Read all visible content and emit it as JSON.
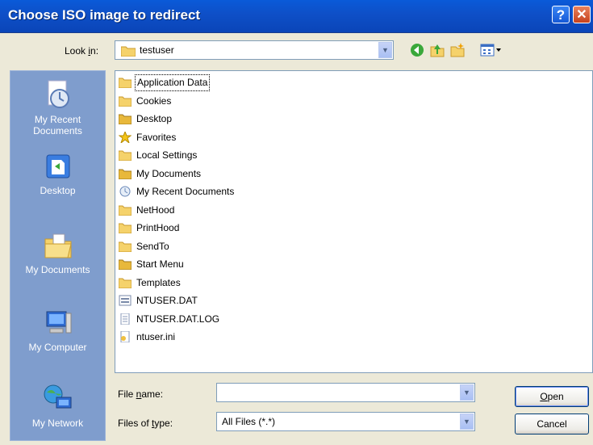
{
  "window": {
    "title": "Choose ISO image to redirect",
    "help_icon": "question-icon",
    "close_icon": "close-icon"
  },
  "toolbar": {
    "lookin_label_pre": "Look ",
    "lookin_label_u": "i",
    "lookin_label_post": "n:",
    "lookin_value": "testuser",
    "tools": [
      "back-icon",
      "up-folder-icon",
      "new-folder-icon",
      "views-menu-icon"
    ]
  },
  "places": [
    {
      "label": "My Recent Documents",
      "icon": "recent-documents-icon"
    },
    {
      "label": "Desktop",
      "icon": "desktop-icon"
    },
    {
      "label": "My Documents",
      "icon": "my-documents-icon"
    },
    {
      "label": "My Computer",
      "icon": "my-computer-icon"
    },
    {
      "label": "My Network",
      "icon": "my-network-icon"
    }
  ],
  "files": [
    {
      "name": "Application Data",
      "icon": "folder"
    },
    {
      "name": "Cookies",
      "icon": "folder"
    },
    {
      "name": "Desktop",
      "icon": "folder-special"
    },
    {
      "name": "Favorites",
      "icon": "favorites"
    },
    {
      "name": "Local Settings",
      "icon": "folder"
    },
    {
      "name": "My Documents",
      "icon": "folder-special"
    },
    {
      "name": "My Recent Documents",
      "icon": "recent"
    },
    {
      "name": "NetHood",
      "icon": "folder"
    },
    {
      "name": "PrintHood",
      "icon": "folder"
    },
    {
      "name": "SendTo",
      "icon": "folder"
    },
    {
      "name": "Start Menu",
      "icon": "folder-special"
    },
    {
      "name": "Templates",
      "icon": "folder"
    },
    {
      "name": "NTUSER.DAT",
      "icon": "dat-file"
    },
    {
      "name": "NTUSER.DAT.LOG",
      "icon": "log-file"
    },
    {
      "name": "ntuser.ini",
      "icon": "ini-file"
    }
  ],
  "form": {
    "filename_label_pre": "File ",
    "filename_label_u": "n",
    "filename_label_post": "ame:",
    "filename_value": "",
    "filetype_label_pre": "Files of ",
    "filetype_label_u": "t",
    "filetype_label_post": "ype:",
    "filetype_value": "All Files (*.*)"
  },
  "buttons": {
    "open_u": "O",
    "open_rest": "pen",
    "cancel": "Cancel"
  },
  "colors": {
    "title_blue": "#0e4fc7",
    "places_bg": "#7f9dcd",
    "dialog_bg": "#ece9d8",
    "folder_yellow": "#f5d26b"
  }
}
